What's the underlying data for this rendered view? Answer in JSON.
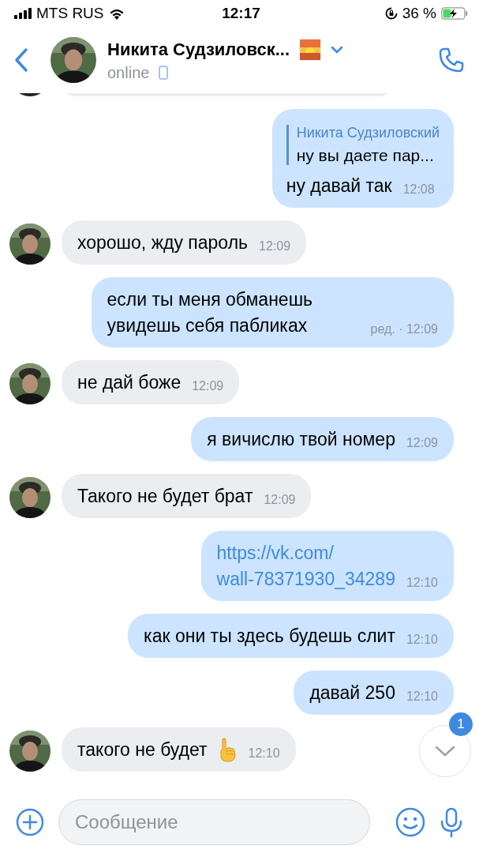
{
  "status_bar": {
    "carrier": "MTS RUS",
    "time": "12:17",
    "battery": "36 %"
  },
  "header": {
    "name": "Никита Судзиловск...",
    "status": "online"
  },
  "messages": [
    {
      "kind": "partial"
    },
    {
      "kind": "reply",
      "quote_author": "Никита Судзиловский",
      "quote_text": "ну вы даете пар...",
      "text": "ну давай так",
      "time": "12:08"
    },
    {
      "kind": "in",
      "text": "хорошо, жду пароль",
      "time": "12:09"
    },
    {
      "kind": "out",
      "text": "если ты меня обманешь увидешь себя пабликах",
      "time": "ред. · 12:09"
    },
    {
      "kind": "in",
      "text": "не дай боже",
      "time": "12:09"
    },
    {
      "kind": "out",
      "text": "я вичислю твой номер",
      "time": "12:09"
    },
    {
      "kind": "in",
      "text": "Такого не будет брат",
      "time": "12:09"
    },
    {
      "kind": "link",
      "lines": [
        "https://vk.com/",
        "wall-78371930_34289"
      ],
      "time": "12:10"
    },
    {
      "kind": "out",
      "text": "как они ты здесь будешь слит",
      "time": "12:10"
    },
    {
      "kind": "out",
      "text": "давай 250",
      "time": "12:10"
    },
    {
      "kind": "in_hand",
      "text": "такого не будет",
      "time": "12:10"
    }
  ],
  "scroll_button": {
    "badge": "1"
  },
  "composer": {
    "placeholder": "Сообщение"
  }
}
